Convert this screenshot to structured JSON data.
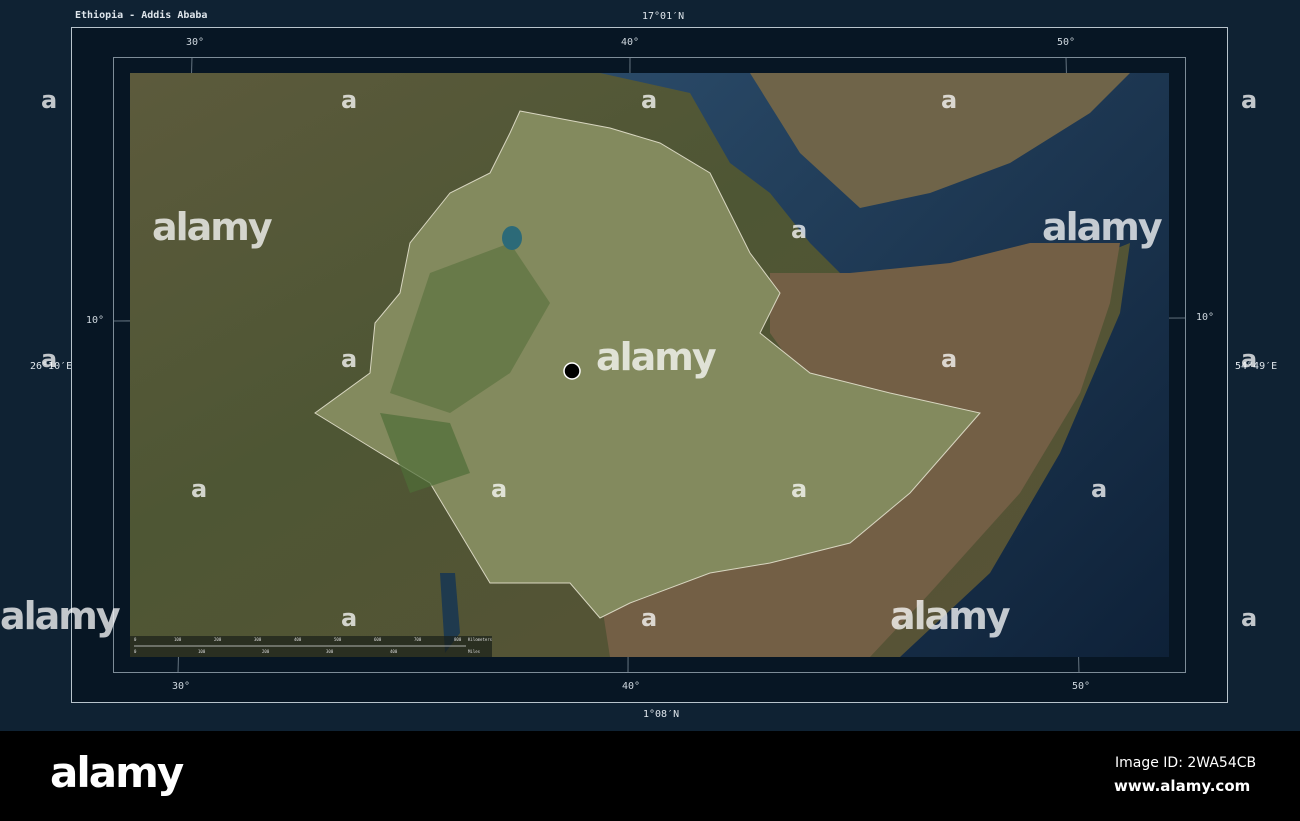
{
  "map": {
    "title": "Ethiopia - Addis Ababa",
    "top_coord": "17°01′N",
    "bottom_coord": "1°08′N",
    "left_coord": "26°10′E",
    "right_coord": "54°49′E",
    "lon_ticks": [
      "30°",
      "40°",
      "50°"
    ],
    "lat_ticks": [
      "10°"
    ],
    "capital_marker": "Addis Ababa",
    "scale_bar": {
      "km_label": "Kilometers",
      "mi_label": "Miles",
      "km_ticks": [
        "0",
        "100",
        "200",
        "300",
        "400",
        "500",
        "600",
        "700",
        "800"
      ],
      "mi_ticks": [
        "0",
        "100",
        "200",
        "300",
        "400"
      ]
    },
    "colors": {
      "frame_bg": "#0f2233",
      "sea": "#1c3550",
      "land": "#6d6548",
      "ethiopia": "#8a9468"
    }
  },
  "watermark": {
    "text": "alamy",
    "letter": "a",
    "image_id": "Image ID: 2WA54CB",
    "site": "www.alamy.com"
  }
}
